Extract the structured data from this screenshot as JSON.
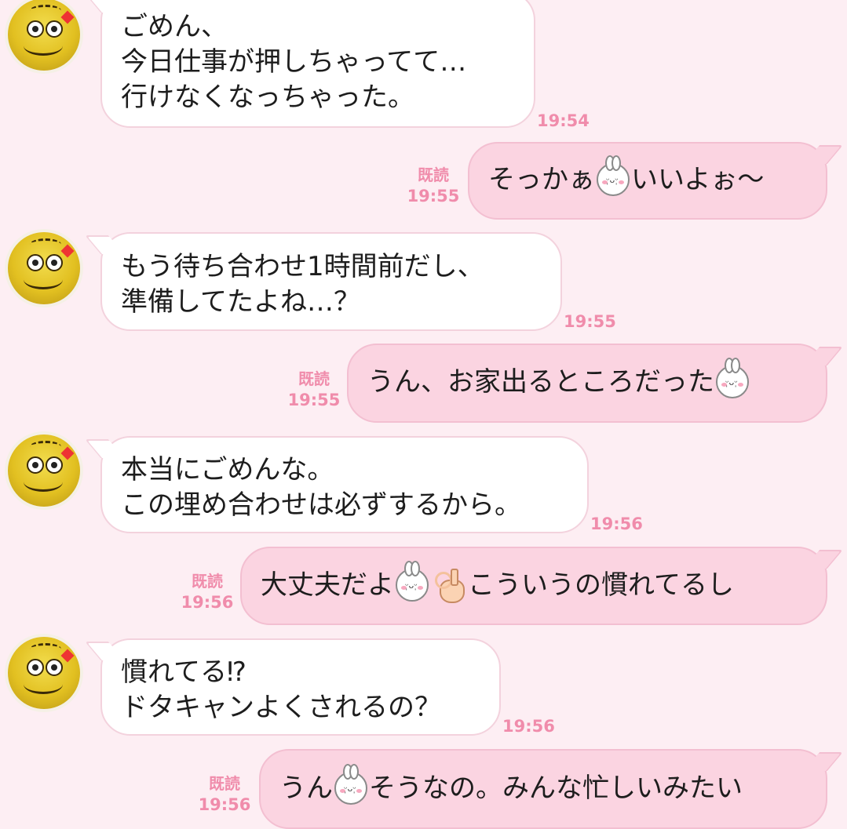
{
  "messages": [
    {
      "from": "them",
      "lines": [
        "ごめん、",
        "今日仕事が押しちゃってて…",
        "行けなくなっちゃった。"
      ],
      "time": "19:54"
    },
    {
      "from": "me",
      "parts": [
        "そっかぁ",
        "[bunny-emoji]",
        "いいよぉ〜"
      ],
      "read": "既読",
      "time": "19:55"
    },
    {
      "from": "them",
      "lines": [
        "もう待ち合わせ1時間前だし、",
        "準備してたよね…？"
      ],
      "time": "19:55"
    },
    {
      "from": "me",
      "parts": [
        "うん、お家出るところだった",
        "[bunny-emoji]"
      ],
      "read": "既読",
      "time": "19:55"
    },
    {
      "from": "them",
      "lines": [
        "本当にごめんな。",
        "この埋め合わせは必ずするから。"
      ],
      "time": "19:56"
    },
    {
      "from": "me",
      "parts": [
        "大丈夫だよ",
        "[bunny-emoji]",
        "[ok-hand-emoji]",
        "こういうの慣れてるし"
      ],
      "read": "既読",
      "time": "19:56"
    },
    {
      "from": "them",
      "lines": [
        "慣れてる⁉︎",
        "ドタキャンよくされるの？"
      ],
      "time": "19:56"
    },
    {
      "from": "me",
      "parts": [
        "うん",
        "[bunny-emoji]",
        "そうなの。みんな忙しいみたい"
      ],
      "read": "既読",
      "time": "19:56"
    }
  ],
  "icons": {
    "emoji": "bunny-face-icon",
    "hand": "ok-hand-icon",
    "avatar": "yellow-character-avatar"
  },
  "colors": {
    "background": "#fdeef3",
    "outgoing_bubble": "#fbd4e1",
    "incoming_bubble": "#ffffff",
    "timestamp": "#f08cab"
  }
}
